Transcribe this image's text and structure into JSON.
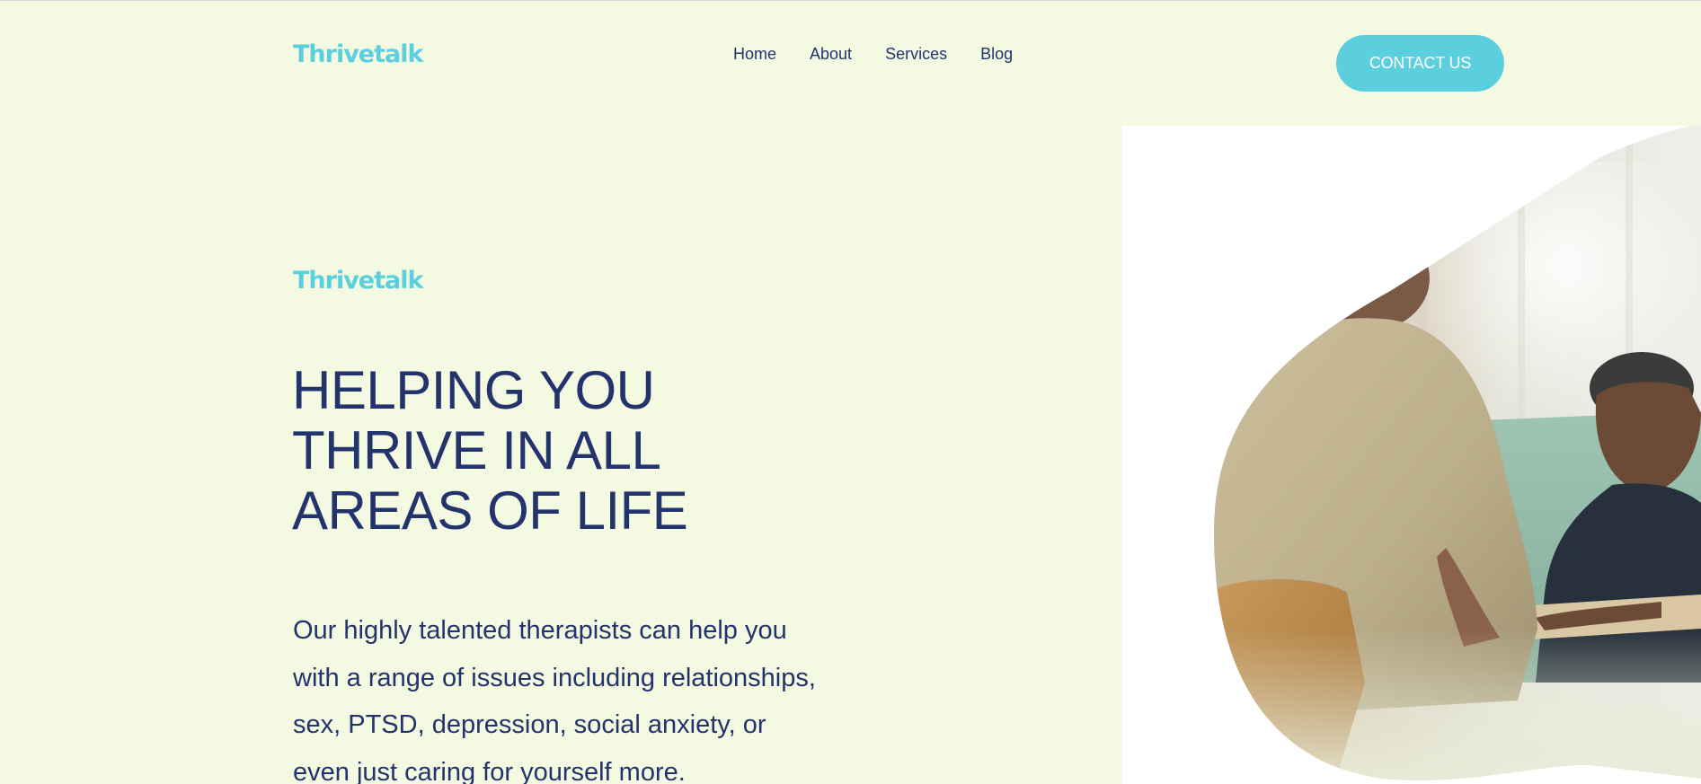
{
  "header": {
    "logo": "Thrivetalk",
    "nav": [
      {
        "label": "Home"
      },
      {
        "label": "About"
      },
      {
        "label": "Services"
      },
      {
        "label": "Blog"
      }
    ],
    "cta_label": "CONTACT US"
  },
  "hero": {
    "brand": "Thrivetalk",
    "headline_lines": [
      "HELPING YOU",
      "THRIVE IN ALL",
      "AREAS OF LIFE"
    ],
    "body_lines": [
      "Our highly talented therapists can help you",
      "with a range of issues including relationships,",
      "sex, PTSD, depression, social anxiety, or",
      "even just caring for yourself more."
    ],
    "image": {
      "subject": "two-people-therapy-session-photo"
    }
  },
  "colors": {
    "background": "#f4f9e2",
    "accent": "#5ccfde",
    "text": "#23336b",
    "panel": "#ffffff"
  }
}
